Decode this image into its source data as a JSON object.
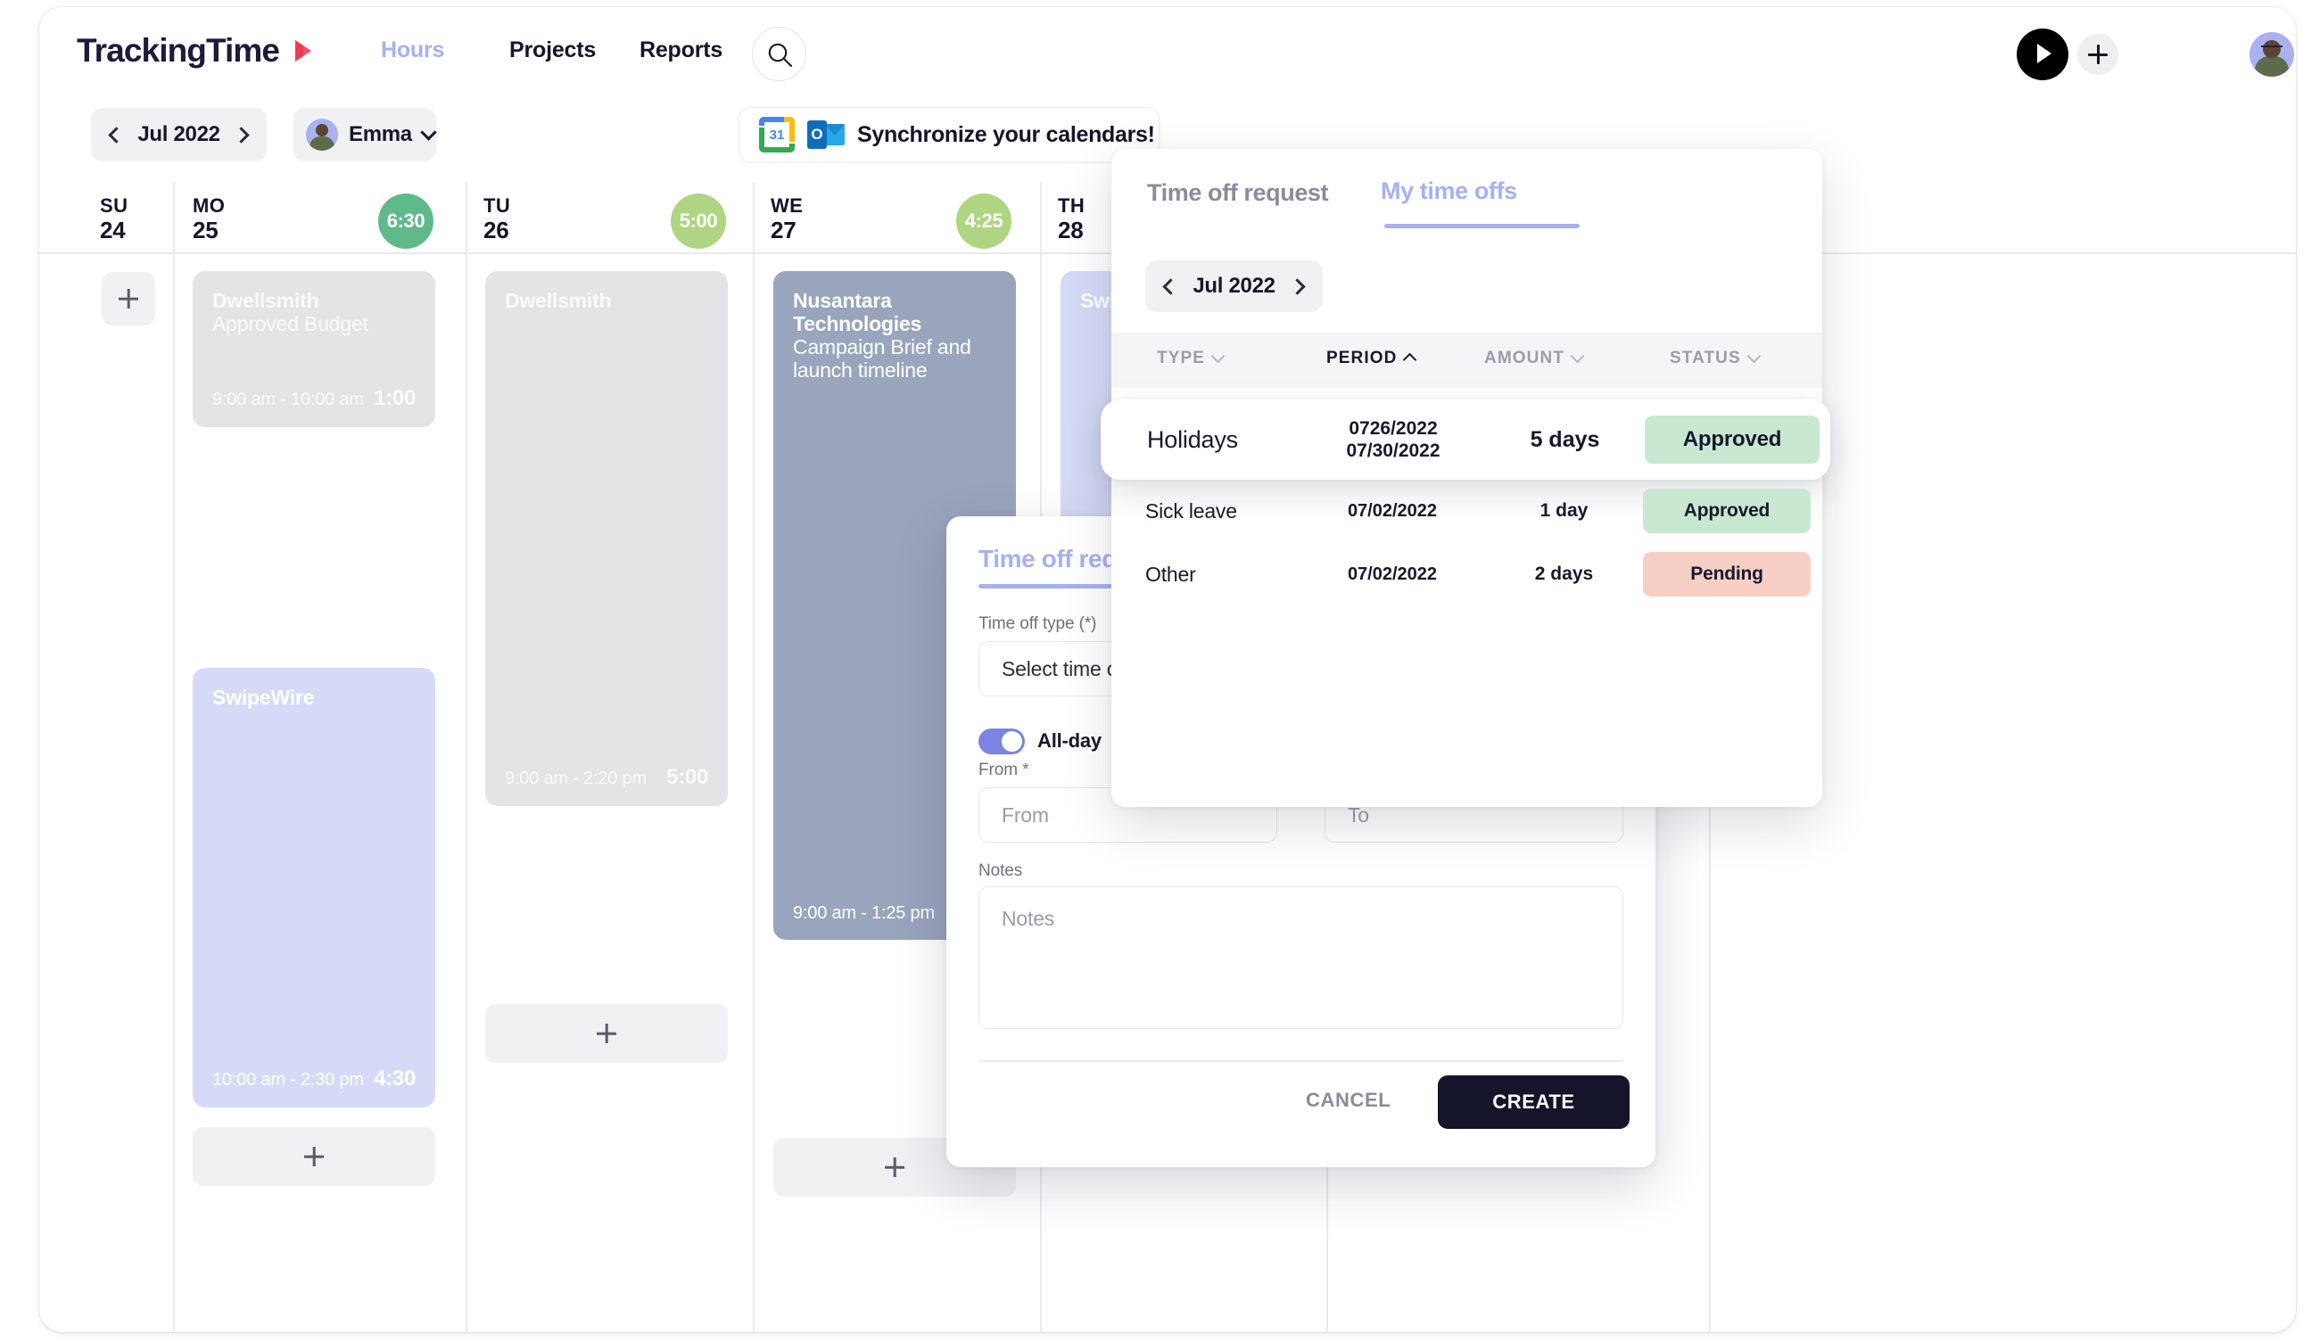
{
  "app": {
    "brand": "TrackingTime",
    "nav": [
      {
        "label": "Hours",
        "active": true
      },
      {
        "label": "Projects",
        "active": false
      },
      {
        "label": "Reports",
        "active": false
      }
    ]
  },
  "toolbar": {
    "date_label": "Jul 2022",
    "user_name": "Emma",
    "sync_banner": "Synchronize your calendars!",
    "gcal_day": "31",
    "outlook_letter": "O"
  },
  "week": {
    "days": [
      {
        "dow": "SU",
        "num": "24",
        "total": ""
      },
      {
        "dow": "MO",
        "num": "25",
        "total": "6:30"
      },
      {
        "dow": "TU",
        "num": "26",
        "total": "5:00"
      },
      {
        "dow": "WE",
        "num": "27",
        "total": "4:25"
      },
      {
        "dow": "TH",
        "num": "28",
        "total": ""
      }
    ],
    "events": [
      {
        "project": "Dwellsmith",
        "task": "Approved Budget",
        "time": "9:00 am - 10:00 am",
        "duration": "1:00"
      },
      {
        "project": "SwipeWire",
        "task": "",
        "time": "10:00 am - 2:30 pm",
        "duration": "4:30"
      },
      {
        "project": "Dwellsmith",
        "task": "",
        "time": "9:00 am - 2:20 pm",
        "duration": "5:00"
      },
      {
        "project": "Nusantara Technologies",
        "task": "Campaign Brief and launch timeline",
        "time": "9:00 am - 1:25 pm",
        "duration": ""
      },
      {
        "project": "SwipeWire",
        "task": "",
        "time": "",
        "duration": ""
      }
    ]
  },
  "time_off_request": {
    "title": "Time off request",
    "type_label": "Time off type (*)",
    "type_placeholder": "Select time off",
    "allday_label": "All-day",
    "from_label": "From *",
    "from_placeholder": "From",
    "to_placeholder": "To",
    "notes_label": "Notes",
    "notes_placeholder": "Notes",
    "cancel_label": "CANCEL",
    "create_label": "CREATE"
  },
  "time_offs_panel": {
    "tab_request": "Time off request",
    "tab_mine": "My time offs",
    "date_label": "Jul 2022",
    "columns": [
      {
        "label": "TYPE",
        "sorted": false,
        "dir": "down"
      },
      {
        "label": "PERIOD",
        "sorted": true,
        "dir": "up"
      },
      {
        "label": "AMOUNT",
        "sorted": false,
        "dir": "down"
      },
      {
        "label": "STATUS",
        "sorted": false,
        "dir": "down"
      }
    ],
    "rows": [
      {
        "type": "Holidays",
        "period_1": "0726/2022",
        "period_2": "07/30/2022",
        "amount": "5 days",
        "status": "Approved",
        "status_kind": "ok"
      },
      {
        "type": "Sick leave",
        "period_1": "07/02/2022",
        "period_2": "",
        "amount": "1 day",
        "status": "Approved",
        "status_kind": "ok"
      },
      {
        "type": "Other",
        "period_1": "07/02/2022",
        "period_2": "",
        "amount": "2 days",
        "status": "Pending",
        "status_kind": "pend"
      }
    ]
  },
  "colors": {
    "accent_lavender": "#a6b1f0",
    "ink": "#14142b",
    "approved_bg": "#c8e8d2",
    "pending_bg": "#f7cfc4",
    "badge_green_dark": "#5fba8a",
    "badge_green_light": "#aed581"
  }
}
